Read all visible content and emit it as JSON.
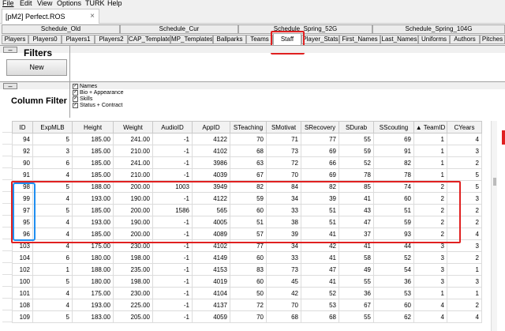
{
  "menu": [
    "File",
    "Edit",
    "View",
    "Options",
    "TURK",
    "Help"
  ],
  "document_tab": {
    "title": "[pM2] Perfect.ROS",
    "close": "×"
  },
  "tabs_top": [
    "Schedule_Old",
    "Schedule_Cur",
    "Schedule_Spring_52G",
    "Schedule_Spring_104G"
  ],
  "tabs_bottom": [
    "Players",
    "Players0",
    "Players1",
    "Players2",
    "CAP_Templates",
    "MP_Templates",
    "Ballparks",
    "Teams",
    "Staff",
    "Player_Stats",
    "First_Names",
    "Last_Names",
    "Uniforms",
    "Authors",
    "Pitches"
  ],
  "active_tab": "Staff",
  "filters": {
    "label": "Filters",
    "new_button": "New",
    "collapse": "–"
  },
  "column_filter": {
    "label": "Column Filter",
    "collapse": "–",
    "options": [
      {
        "label": "Names",
        "checked": true
      },
      {
        "label": "Bio + Appearance",
        "checked": true
      },
      {
        "label": "Skills",
        "checked": true
      },
      {
        "label": "Status + Contract",
        "checked": true
      }
    ]
  },
  "grid": {
    "columns": [
      "ID",
      "ExpMLB",
      "Height",
      "Weight",
      "AudioID",
      "AppID",
      "STeaching",
      "SMotivat",
      "SRecovery",
      "SDurab",
      "SScouting",
      "▲ TeamID",
      "CYears"
    ],
    "rows": [
      [
        "94",
        "5",
        "185.00",
        "241.00",
        "-1",
        "4122",
        "70",
        "71",
        "77",
        "55",
        "69",
        "1",
        "4"
      ],
      [
        "92",
        "3",
        "185.00",
        "210.00",
        "-1",
        "4102",
        "68",
        "73",
        "69",
        "59",
        "91",
        "1",
        "3"
      ],
      [
        "90",
        "6",
        "185.00",
        "241.00",
        "-1",
        "3986",
        "63",
        "72",
        "66",
        "52",
        "82",
        "1",
        "2"
      ],
      [
        "91",
        "4",
        "185.00",
        "210.00",
        "-1",
        "4039",
        "67",
        "70",
        "69",
        "78",
        "78",
        "1",
        "5"
      ],
      [
        "98",
        "5",
        "188.00",
        "200.00",
        "1003",
        "3949",
        "82",
        "84",
        "82",
        "85",
        "74",
        "2",
        "5"
      ],
      [
        "99",
        "4",
        "193.00",
        "190.00",
        "-1",
        "4122",
        "59",
        "34",
        "39",
        "41",
        "60",
        "2",
        "3"
      ],
      [
        "97",
        "5",
        "185.00",
        "200.00",
        "1586",
        "565",
        "60",
        "33",
        "51",
        "43",
        "51",
        "2",
        "2"
      ],
      [
        "95",
        "4",
        "193.00",
        "190.00",
        "-1",
        "4005",
        "51",
        "38",
        "51",
        "47",
        "59",
        "2",
        "2"
      ],
      [
        "96",
        "4",
        "185.00",
        "200.00",
        "-1",
        "4089",
        "57",
        "39",
        "41",
        "37",
        "93",
        "2",
        "4"
      ],
      [
        "103",
        "4",
        "175.00",
        "230.00",
        "-1",
        "4102",
        "77",
        "34",
        "42",
        "41",
        "44",
        "3",
        "3"
      ],
      [
        "104",
        "6",
        "180.00",
        "198.00",
        "-1",
        "4149",
        "60",
        "33",
        "41",
        "58",
        "52",
        "3",
        "2"
      ],
      [
        "102",
        "1",
        "188.00",
        "235.00",
        "-1",
        "4153",
        "83",
        "73",
        "47",
        "49",
        "54",
        "3",
        "1"
      ],
      [
        "100",
        "5",
        "180.00",
        "198.00",
        "-1",
        "4019",
        "60",
        "45",
        "41",
        "55",
        "36",
        "3",
        "3"
      ],
      [
        "101",
        "4",
        "175.00",
        "230.00",
        "-1",
        "4104",
        "50",
        "42",
        "52",
        "36",
        "53",
        "1",
        "1"
      ],
      [
        "108",
        "4",
        "193.00",
        "225.00",
        "-1",
        "4137",
        "72",
        "70",
        "53",
        "67",
        "60",
        "4",
        "2"
      ],
      [
        "109",
        "5",
        "183.00",
        "205.00",
        "-1",
        "4059",
        "70",
        "68",
        "68",
        "55",
        "62",
        "4",
        "4"
      ]
    ]
  }
}
